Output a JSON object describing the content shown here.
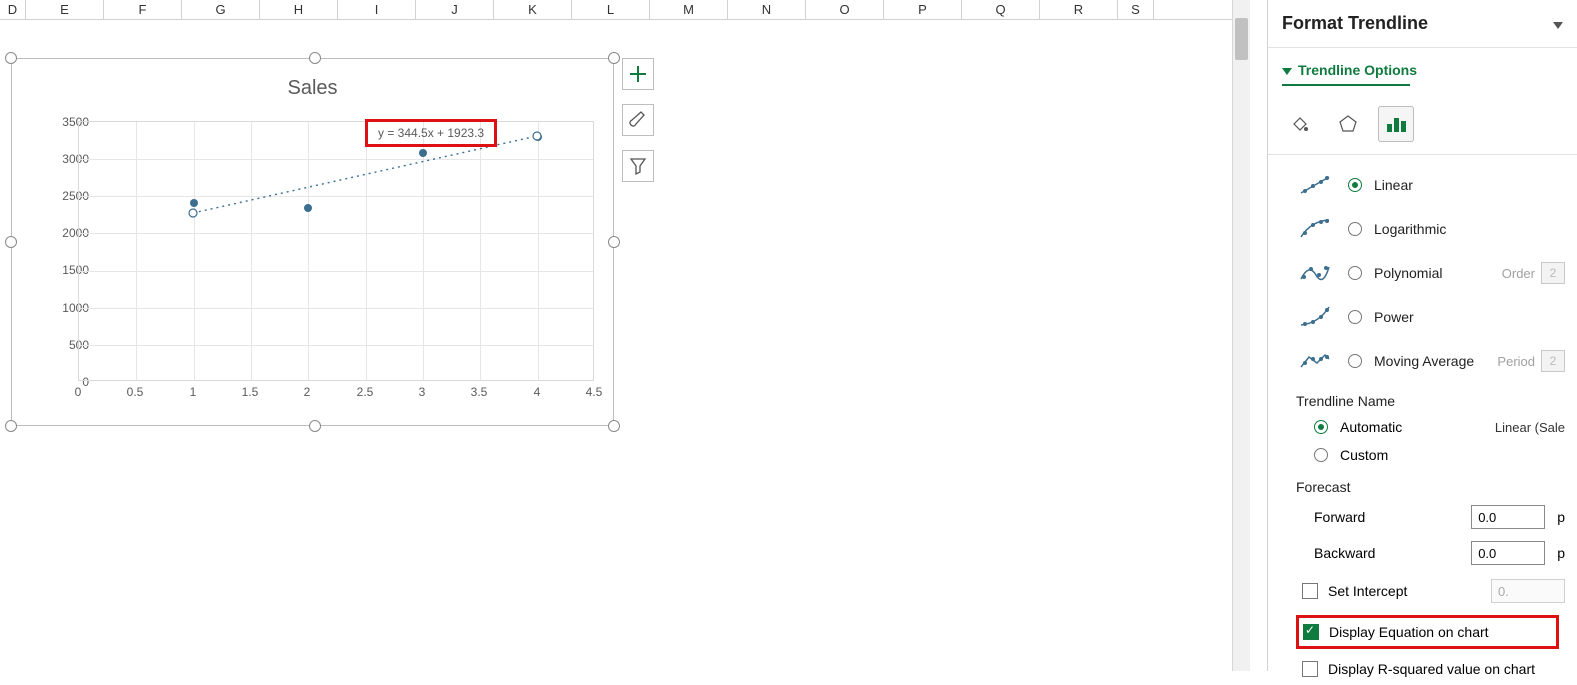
{
  "columns": [
    "D",
    "E",
    "F",
    "G",
    "H",
    "I",
    "J",
    "K",
    "L",
    "M",
    "N",
    "O",
    "P",
    "Q",
    "R",
    "S"
  ],
  "chart": {
    "title": "Sales",
    "equation": "y = 344.5x + 1923.3",
    "xticks": [
      "0",
      "0.5",
      "1",
      "1.5",
      "2",
      "2.5",
      "3",
      "3.5",
      "4",
      "4.5"
    ],
    "yticks": [
      "0",
      "500",
      "1000",
      "1500",
      "2000",
      "2500",
      "3000",
      "3500"
    ]
  },
  "chart_data": {
    "type": "scatter",
    "title": "Sales",
    "series": [
      {
        "name": "Sales",
        "x": [
          1,
          2,
          3,
          4
        ],
        "y": [
          2410,
          2350,
          3080,
          3300
        ]
      }
    ],
    "trendline": {
      "type": "linear",
      "slope": 344.5,
      "intercept": 1923.3,
      "equation": "y = 344.5x + 1923.3"
    },
    "xlabel": "",
    "ylabel": "",
    "xlim": [
      0,
      4.5
    ],
    "ylim": [
      0,
      3500
    ],
    "grid": true
  },
  "side_buttons": {
    "plus": "+",
    "brush": "brush",
    "filter": "filter"
  },
  "pane": {
    "title": "Format Trendline",
    "tab": "Trendline Options",
    "types": {
      "linear": {
        "label": "Linear",
        "selected": true
      },
      "logarithmic": {
        "label": "Logarithmic",
        "selected": false
      },
      "polynomial": {
        "label": "Polynomial",
        "selected": false,
        "tail_label": "Order",
        "tail_value": "2"
      },
      "power": {
        "label": "Power",
        "selected": false
      },
      "moving": {
        "label": "Moving Average",
        "selected": false,
        "tail_label": "Period",
        "tail_value": "2"
      }
    },
    "name_section": "Trendline Name",
    "name": {
      "automatic": "Automatic",
      "custom": "Custom",
      "auto_selected": true,
      "auto_value": "Linear (Sale"
    },
    "forecast_section": "Forecast",
    "forecast": {
      "forward_label": "Forward",
      "forward": "0.0",
      "backward_label": "Backward",
      "backward": "0.0"
    },
    "set_intercept": {
      "label": "Set Intercept",
      "checked": false,
      "value": "0."
    },
    "disp_eq": {
      "label": "Display Equation on chart",
      "checked": true
    },
    "disp_r2": {
      "label": "Display R-squared value on chart",
      "checked": false
    }
  }
}
